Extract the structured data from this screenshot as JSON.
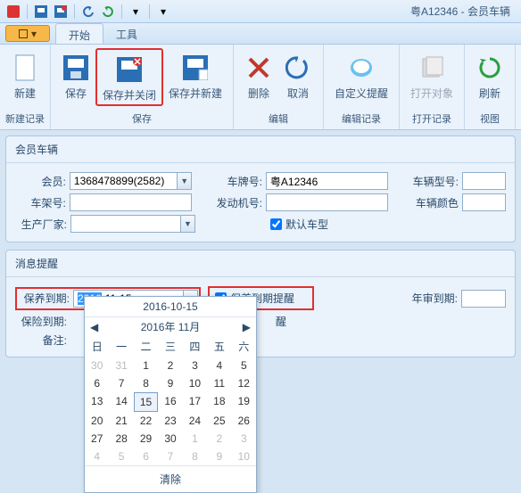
{
  "title": "粤A12346 - 会员车辆",
  "tabs": {
    "start": "开始",
    "tools": "工具"
  },
  "ribbon": {
    "groups": [
      {
        "title": "新建记录",
        "items": [
          {
            "label": "新建",
            "icon": "file-new"
          }
        ]
      },
      {
        "title": "保存",
        "items": [
          {
            "label": "保存",
            "icon": "save"
          },
          {
            "label": "保存并关闭",
            "icon": "save-close",
            "highlight": true
          },
          {
            "label": "保存并新建",
            "icon": "save-new"
          }
        ]
      },
      {
        "title": "编辑",
        "items": [
          {
            "label": "删除",
            "icon": "delete"
          },
          {
            "label": "取消",
            "icon": "cancel"
          }
        ]
      },
      {
        "title": "编辑记录",
        "items": [
          {
            "label": "自定义提醒",
            "icon": "reminder"
          }
        ]
      },
      {
        "title": "打开记录",
        "items": [
          {
            "label": "打开对象",
            "icon": "open",
            "disabled": true
          }
        ]
      },
      {
        "title": "视图",
        "items": [
          {
            "label": "刷新",
            "icon": "refresh"
          }
        ]
      }
    ]
  },
  "section1": {
    "title": "会员车辆",
    "member_label": "会员:",
    "member_value": "1368478899(2582)",
    "plate_label": "车牌号:",
    "plate_value": "粤A12346",
    "model_label": "车辆型号:",
    "model_value": "",
    "vin_label": "车架号:",
    "vin_value": "",
    "engine_label": "发动机号:",
    "engine_value": "",
    "color_label": "车辆颜色",
    "color_value": "",
    "maker_label": "生产厂家:",
    "maker_value": "",
    "default_label": "默认车型"
  },
  "section2": {
    "title": "消息提醒",
    "maint_label": "保养到期:",
    "maint_sel": "2016",
    "maint_rest": "-11-15",
    "maint_chk_label": "保养到期提醒",
    "annual_label": "年审到期:",
    "ins_label": "保险到期:",
    "remind_partial": "醒",
    "remark_label": "备注:"
  },
  "calendar": {
    "top_date": "2016-10-15",
    "month_label": "2016年 11月",
    "dow": [
      "日",
      "一",
      "二",
      "三",
      "四",
      "五",
      "六"
    ],
    "clear": "清除",
    "cells": [
      {
        "d": "30",
        "o": 1
      },
      {
        "d": "31",
        "o": 1
      },
      {
        "d": "1"
      },
      {
        "d": "2"
      },
      {
        "d": "3"
      },
      {
        "d": "4"
      },
      {
        "d": "5"
      },
      {
        "d": "6"
      },
      {
        "d": "7"
      },
      {
        "d": "8"
      },
      {
        "d": "9"
      },
      {
        "d": "10"
      },
      {
        "d": "11"
      },
      {
        "d": "12"
      },
      {
        "d": "13"
      },
      {
        "d": "14"
      },
      {
        "d": "15",
        "s": 1
      },
      {
        "d": "16"
      },
      {
        "d": "17"
      },
      {
        "d": "18"
      },
      {
        "d": "19"
      },
      {
        "d": "20"
      },
      {
        "d": "21"
      },
      {
        "d": "22"
      },
      {
        "d": "23"
      },
      {
        "d": "24"
      },
      {
        "d": "25"
      },
      {
        "d": "26"
      },
      {
        "d": "27"
      },
      {
        "d": "28"
      },
      {
        "d": "29"
      },
      {
        "d": "30"
      },
      {
        "d": "1",
        "o": 1
      },
      {
        "d": "2",
        "o": 1
      },
      {
        "d": "3",
        "o": 1
      },
      {
        "d": "4",
        "o": 1
      },
      {
        "d": "5",
        "o": 1
      },
      {
        "d": "6",
        "o": 1
      },
      {
        "d": "7",
        "o": 1
      },
      {
        "d": "8",
        "o": 1
      },
      {
        "d": "9",
        "o": 1
      },
      {
        "d": "10",
        "o": 1
      }
    ]
  }
}
